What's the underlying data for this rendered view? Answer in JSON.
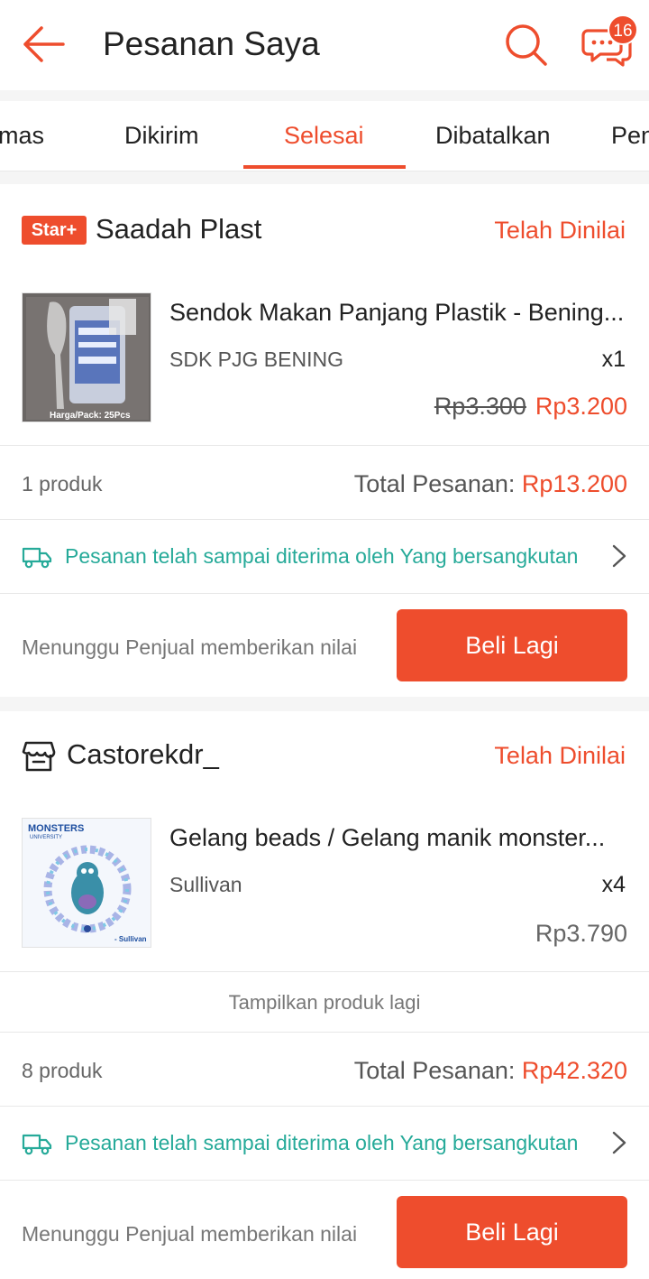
{
  "header": {
    "title": "Pesanan Saya",
    "chat_badge": "16"
  },
  "tabs": [
    {
      "label": "mas"
    },
    {
      "label": "Dikirim"
    },
    {
      "label": "Selesai"
    },
    {
      "label": "Dibatalkan"
    },
    {
      "label": "Pen"
    }
  ],
  "orders": [
    {
      "badge": "Star+",
      "shop": "Saadah Plast",
      "status": "Telah Dinilai",
      "product": {
        "name": "Sendok Makan Panjang Plastik - Bening...",
        "variant": "SDK PJG BENING",
        "qty": "x1",
        "old_price": "Rp3.300",
        "price": "Rp3.200",
        "img_caption": "Harga/Pack: 25Pcs"
      },
      "count": "1 produk",
      "total_label": "Total Pesanan: ",
      "total_value": "Rp13.200",
      "shipping": "Pesanan telah sampai diterima oleh Yang bersangkutan",
      "waiting": "Menunggu Penjual memberikan nilai",
      "button": "Beli Lagi"
    },
    {
      "shop": "Castorekdr_",
      "status": "Telah Dinilai",
      "product": {
        "name": "Gelang beads / Gelang manik monster...",
        "variant": "Sullivan",
        "qty": "x4",
        "price": "Rp3.790",
        "img_brand": "MONSTERS",
        "img_brand_sub": "UNIVERSITY",
        "img_caption": "- Sullivan"
      },
      "show_more": "Tampilkan produk lagi",
      "count": "8 produk",
      "total_label": "Total Pesanan: ",
      "total_value": "Rp42.320",
      "shipping": "Pesanan telah sampai diterima oleh Yang bersangkutan",
      "waiting": "Menunggu Penjual memberikan nilai",
      "button": "Beli Lagi"
    }
  ],
  "colors": {
    "accent": "#ee4d2d",
    "shipping": "#26aa99"
  },
  "icons": [
    "back-arrow-icon",
    "search-icon",
    "chat-icon",
    "store-icon",
    "truck-icon",
    "chevron-right-icon"
  ]
}
